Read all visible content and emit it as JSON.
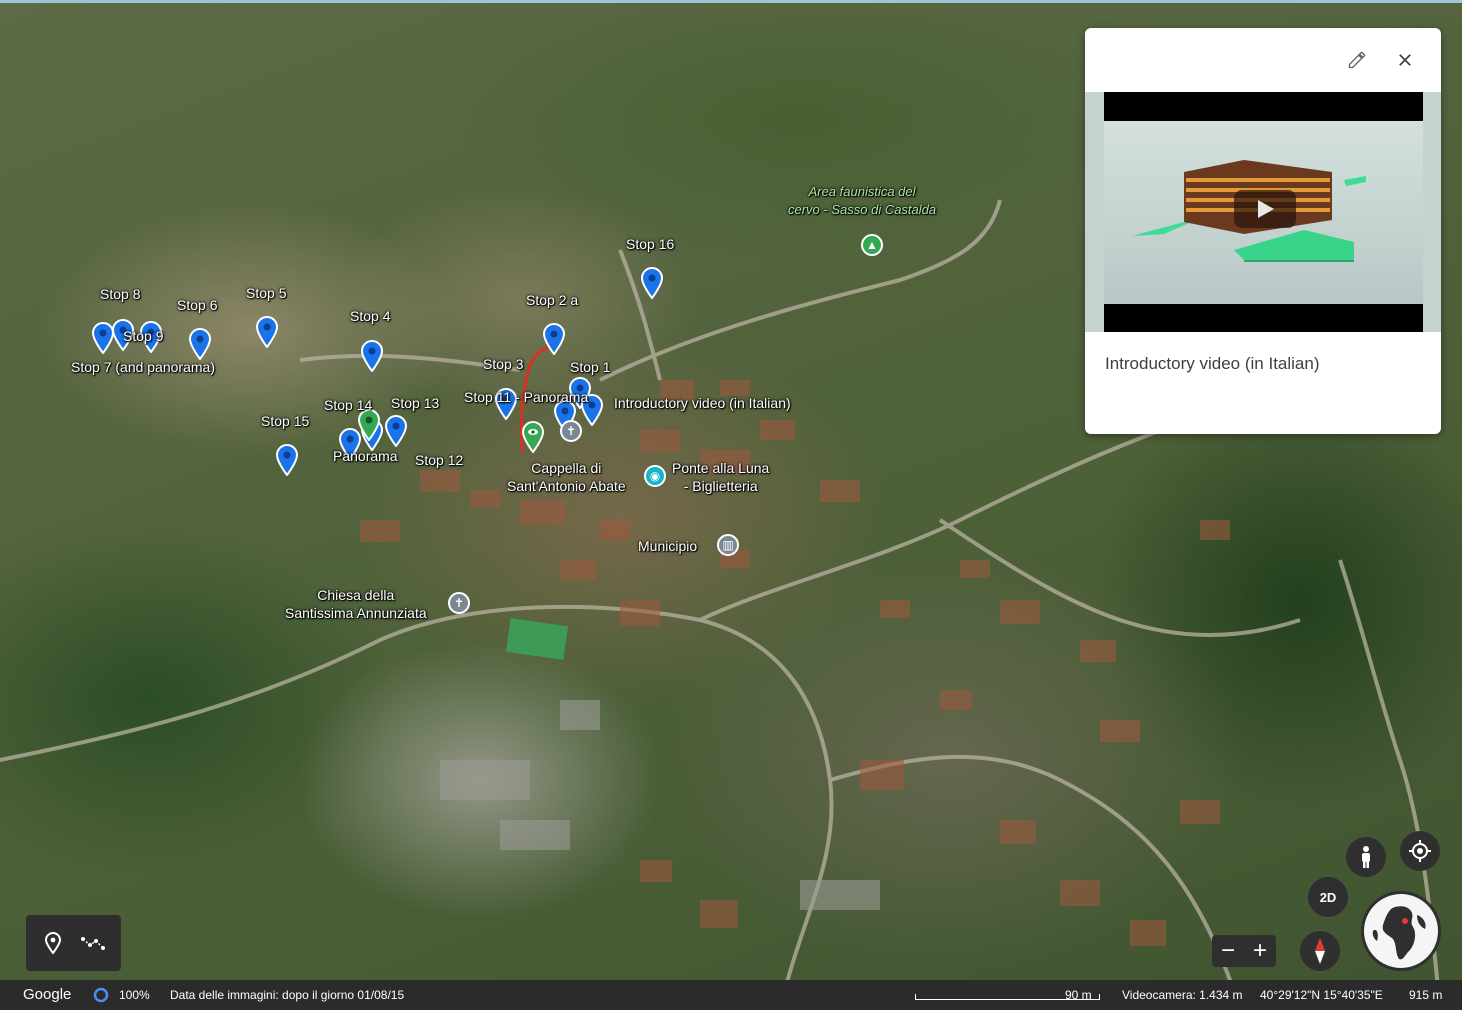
{
  "map": {
    "stops": [
      {
        "label": "Stop 8"
      },
      {
        "label": "Stop 6"
      },
      {
        "label": "Stop 5"
      },
      {
        "label": "Stop 9"
      },
      {
        "label": "Stop 7 (and panorama)"
      },
      {
        "label": "Stop 4"
      },
      {
        "label": "Stop 2 a"
      },
      {
        "label": "Stop 16"
      },
      {
        "label": "Stop 3"
      },
      {
        "label": "Stop 1"
      },
      {
        "label": "Stop 11 - Panorama"
      },
      {
        "label": "Stop 14"
      },
      {
        "label": "Stop 13"
      },
      {
        "label": "Stop 15"
      },
      {
        "label": "Panorama"
      },
      {
        "label": "Stop 12"
      }
    ],
    "video_pin_label": "Introductory video (in Italian)",
    "places": {
      "area_faunistica": [
        "Area faunistica del",
        "cervo - Sasso di Castalda"
      ],
      "cappella": [
        "Cappella di",
        "Sant'Antonio Abate"
      ],
      "ponte": [
        "Ponte alla Luna",
        "- Biglietteria"
      ],
      "municipio": "Municipio",
      "chiesa": [
        "Chiesa della",
        "Santissima Annunziata"
      ]
    },
    "colors": {
      "marker": "#1a73e8",
      "route": "#d93025",
      "green_marker": "#34a853"
    }
  },
  "info_card": {
    "title": "Introductory video (in Italian)",
    "edit_icon": "pencil-icon",
    "close_icon": "close-icon",
    "media": "video-thumbnail"
  },
  "status_bar": {
    "brand": "Google",
    "loading": "100%",
    "imagery_date": "Data delle immagini: dopo il giorno 01/08/15",
    "scale": "90 m",
    "camera": "Videocamera: 1.434 m",
    "coordinates": "40°29'12\"N 15°40'35\"E",
    "elevation": "915 m"
  },
  "controls": {
    "mode_2d": "2D",
    "zoom_out": "−",
    "zoom_in": "+",
    "tools": [
      "placemark-icon",
      "path-icon"
    ]
  }
}
